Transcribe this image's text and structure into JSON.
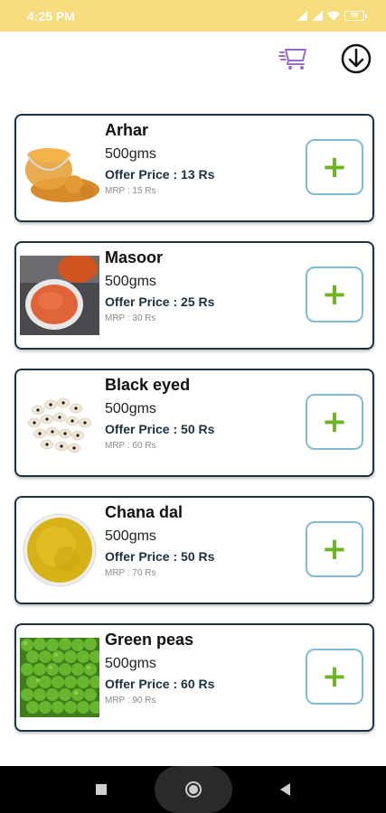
{
  "status_bar": {
    "time": "4:25 PM",
    "battery": "58"
  },
  "header": {
    "cart_icon": "cart-icon",
    "download_icon": "download-circle-icon"
  },
  "products": [
    {
      "name": "Arhar",
      "quantity": "500gms",
      "offer": "Offer Price : 13 Rs",
      "mrp": "MRP : 15 Rs"
    },
    {
      "name": "Masoor",
      "quantity": "500gms",
      "offer": "Offer Price : 25 Rs",
      "mrp": "MRP : 30 Rs"
    },
    {
      "name": "Black eyed",
      "quantity": "500gms",
      "offer": "Offer Price : 50 Rs",
      "mrp": "MRP : 60 Rs"
    },
    {
      "name": "Chana dal",
      "quantity": "500gms",
      "offer": "Offer Price : 50 Rs",
      "mrp": "MRP : 70 Rs"
    },
    {
      "name": "Green peas",
      "quantity": "500gms",
      "offer": "Offer Price : 60 Rs",
      "mrp": "MRP : 90 Rs"
    }
  ],
  "add_button_symbol": "+",
  "colors": {
    "status_bar": "#f7dc7d",
    "card_border": "#1d3344",
    "add_border": "#7fbcd3",
    "add_plus": "#6eb526"
  }
}
